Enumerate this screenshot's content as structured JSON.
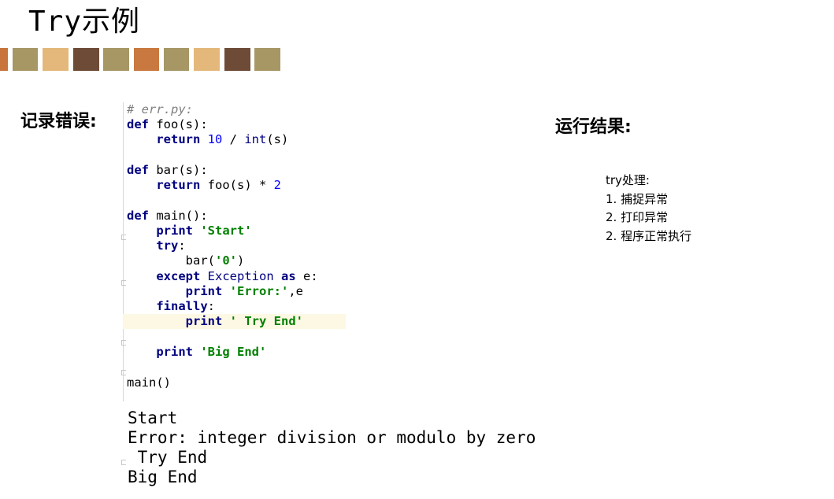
{
  "slide": {
    "title": "Try示例"
  },
  "palette": [
    "#c9743a",
    "#a69765",
    "#e4b87a",
    "#6e4b37",
    "#a69765",
    "#c9783f",
    "#a69765",
    "#e4b87a",
    "#6e4b37",
    "#a69765"
  ],
  "labels": {
    "record_errors": "记录错误:",
    "run_result": "运行结果:"
  },
  "code": {
    "comment": "# err.py:",
    "l2_kw": "def",
    "l2_rest": " foo(s):",
    "l3_indent": "    ",
    "l3_kw": "return",
    "l3_sp": " ",
    "l3_num": "10",
    "l3_op": " / ",
    "l3_bi": "int",
    "l3_rest": "(s)",
    "l5_kw": "def",
    "l5_rest": " bar(s):",
    "l6_indent": "    ",
    "l6_kw": "return",
    "l6_rest": " foo(s) * ",
    "l6_num": "2",
    "l8_kw": "def",
    "l8_rest": " main():",
    "l9_indent": "    ",
    "l9_kw": "print",
    "l9_sp": " ",
    "l9_str": "'Start'",
    "l10_indent": "    ",
    "l10_kw": "try",
    "l10_rest": ":",
    "l11_pre": "        bar(",
    "l11_str": "'0'",
    "l11_post": ")",
    "l12_indent": "    ",
    "l12_kw": "except",
    "l12_sp": " ",
    "l12_bi": "Exception",
    "l12_sp2": " ",
    "l12_kw2": "as",
    "l12_rest": " e:",
    "l13_indent": "        ",
    "l13_kw": "print",
    "l13_sp": " ",
    "l13_str": "'Error:'",
    "l13_rest": ",e",
    "l14_indent": "    ",
    "l14_kw": "finally",
    "l14_rest": ":",
    "l15_indent": "        ",
    "l15_kw": "print",
    "l15_sp": " ",
    "l15_str": "' Try End'",
    "l17_indent": "    ",
    "l17_kw": "print",
    "l17_sp": " ",
    "l17_str": "'Big End'",
    "l19": "main()"
  },
  "output": [
    "Start",
    "Error: integer division or modulo by zero",
    " Try End",
    "Big End"
  ],
  "notes": [
    "try处理:",
    "1. 捕捉异常",
    "2. 打印异常",
    "2.  程序正常执行"
  ]
}
